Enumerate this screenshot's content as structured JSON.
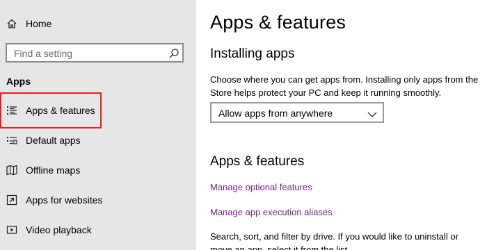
{
  "sidebar": {
    "home_label": "Home",
    "search": {
      "placeholder": "Find a setting"
    },
    "section_label": "Apps",
    "items": [
      {
        "label": "Apps & features",
        "icon": "list-icon"
      },
      {
        "label": "Default apps",
        "icon": "default-apps-icon"
      },
      {
        "label": "Offline maps",
        "icon": "map-icon"
      },
      {
        "label": "Apps for websites",
        "icon": "open-in-window-icon"
      },
      {
        "label": "Video playback",
        "icon": "video-icon"
      }
    ],
    "selected_item": "Apps & features",
    "highlight_color": "#e41e26"
  },
  "main": {
    "title": "Apps & features",
    "installing": {
      "heading": "Installing apps",
      "description_lines": [
        "Choose where you can get apps from. Installing only apps from the",
        "Store helps protect your PC and keep it running smoothly."
      ],
      "dropdown_value": "Allow apps from anywhere"
    },
    "apps_features": {
      "heading": "Apps & features",
      "links": [
        "Manage optional features",
        "Manage app execution aliases"
      ],
      "description_lines": [
        "Search, sort, and filter by drive. If you would like to uninstall or",
        "move an app, select it from the list."
      ]
    },
    "link_color": "#7a1f8a"
  }
}
